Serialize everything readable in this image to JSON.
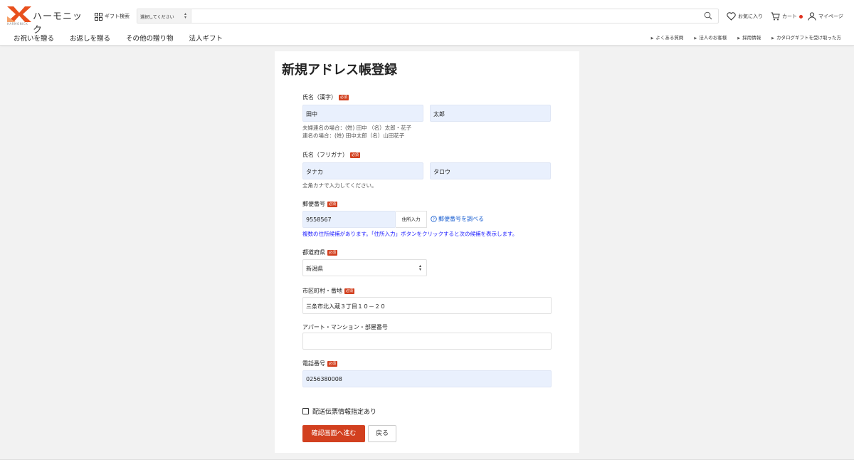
{
  "header": {
    "logo_text": "ハーモニック",
    "logo_sub": "HARMONICK",
    "gift_search_label": "ギフト検索",
    "search_select": "選択してください",
    "favorites": "お気に入り",
    "cart": "カート",
    "mypage": "マイページ",
    "nav_left": [
      "お祝いを贈る",
      "お返しを贈る",
      "その他の贈り物",
      "法人ギフト"
    ],
    "nav_right": [
      "よくある質問",
      "法人のお客様",
      "採用情報",
      "カタログギフトを受け取った方"
    ]
  },
  "form": {
    "title": "新規アドレス帳登録",
    "required_badge": "必須",
    "name_kanji": {
      "label": "氏名（漢字）",
      "last": "田中",
      "first": "太郎"
    },
    "name_hint_1": "夫婦連名の場合：(姓) 田中 （名）太郎・花子",
    "name_hint_2": "連名の場合：(姓) 田中太郎（名）山田花子",
    "name_kana": {
      "label": "氏名（フリガナ）",
      "last": "タナカ",
      "first": "タロウ"
    },
    "kana_hint": "全角カナで入力してください。",
    "zip": {
      "label": "郵便番号",
      "value": "9558567",
      "button": "住所入力",
      "lookup_link": "郵便番号を調べる"
    },
    "zip_note": "複数の住所候補があります。「住所入力」ボタンをクリックすると次の候補を表示します。",
    "prefecture": {
      "label": "都道府県",
      "value": "新潟県"
    },
    "city": {
      "label": "市区町村・番地",
      "value": "三条市北入蔵３丁目１０－２０"
    },
    "building": {
      "label": "アパート・マンション・部屋番号",
      "value": ""
    },
    "phone": {
      "label": "電話番号",
      "value": "0256380008"
    },
    "checkbox_label": "配送伝票情報指定あり",
    "confirm_button": "確認画面へ進む",
    "back_button": "戻る"
  },
  "colors": {
    "accent": "#d2401f",
    "input_fill": "#e9f0fd",
    "link": "#1a5fd1"
  }
}
